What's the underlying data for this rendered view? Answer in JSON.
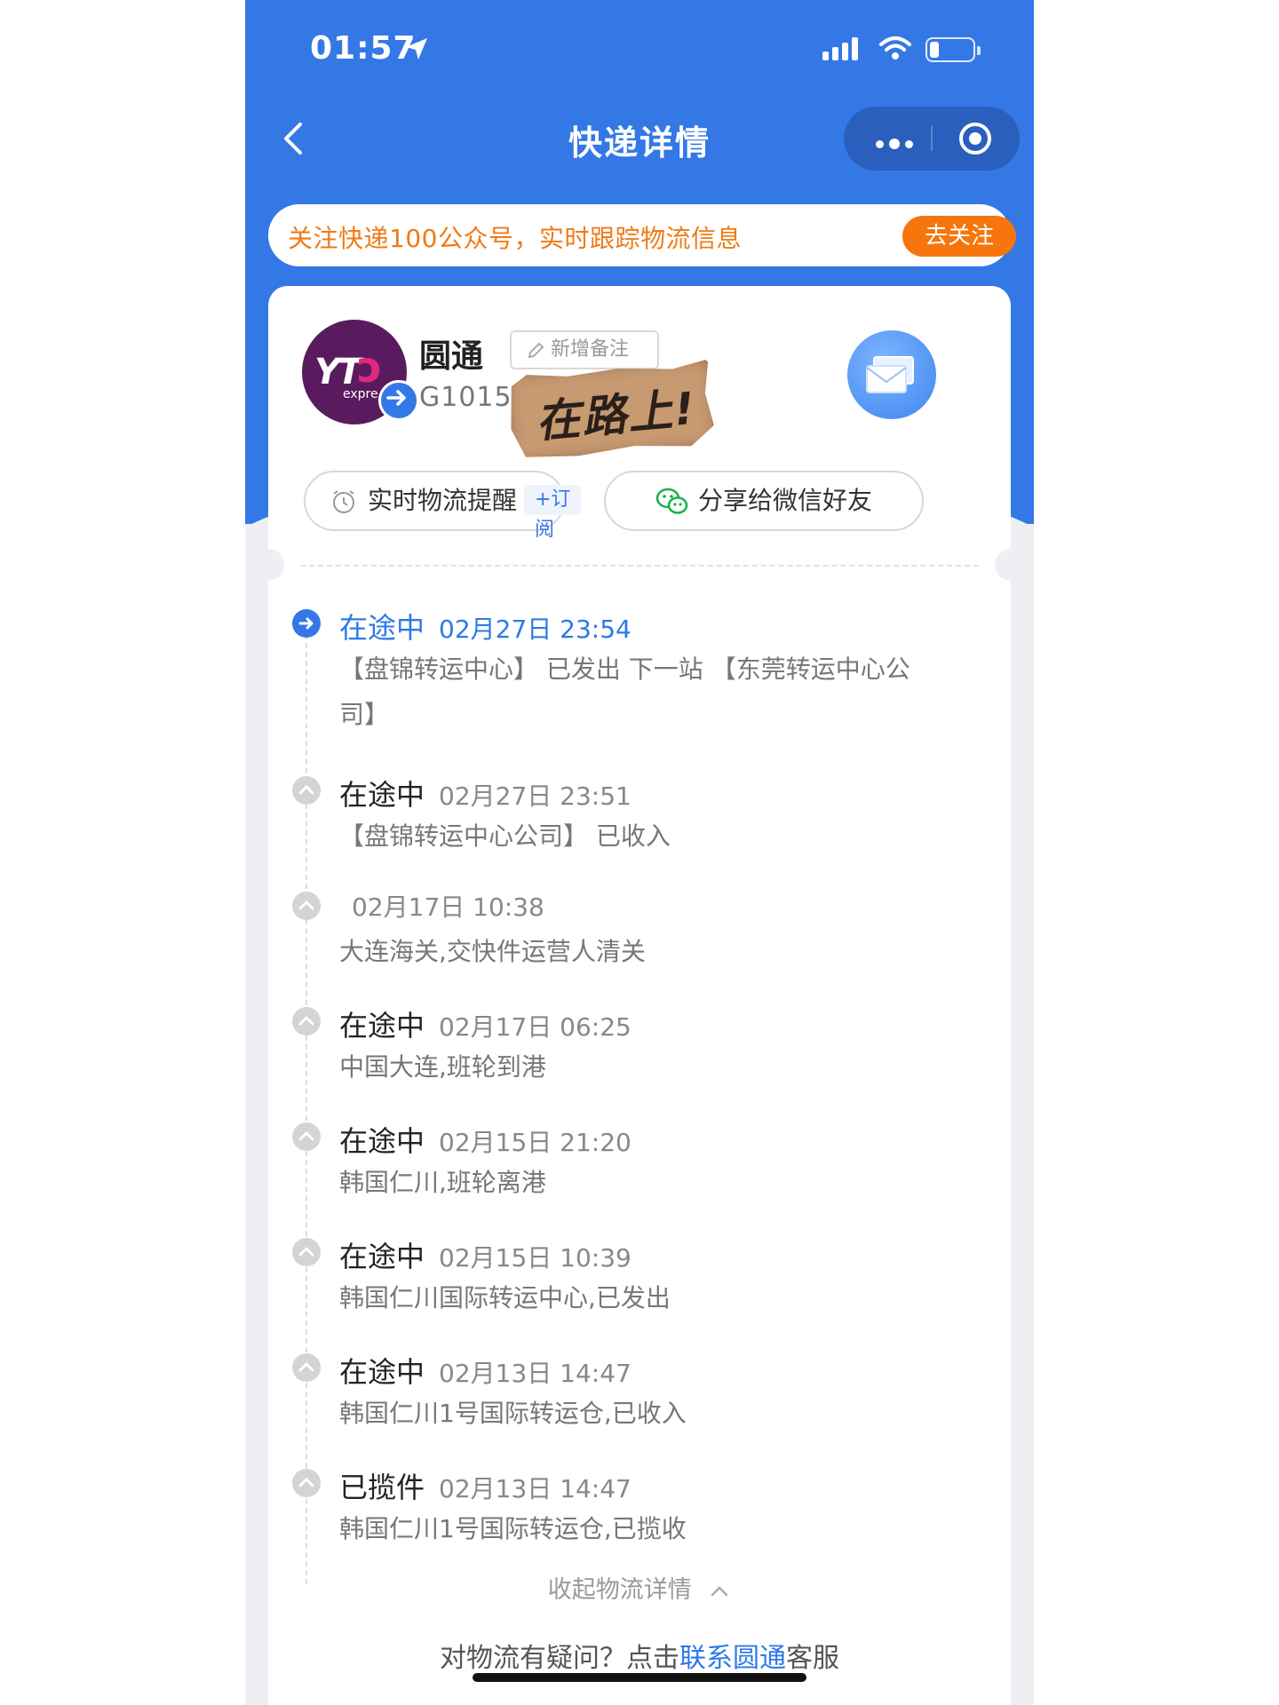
{
  "status_bar": {
    "time": "01:57"
  },
  "nav": {
    "title": "快递详情"
  },
  "banner": {
    "text": "关注快递100公众号，实时跟踪物流信息",
    "button": "去关注"
  },
  "package": {
    "logo_text": "YT",
    "logo_sub": "expre",
    "carrier": "圆通",
    "note_button": "新增备注",
    "tracking": "G101547",
    "sticker": "在路上!",
    "subscribe_label": "实时物流提醒",
    "subscribe_badge": "+订阅",
    "share_label": "分享给微信好友"
  },
  "timeline": [
    {
      "status": "在途中",
      "datetime": "02月27日 23:54",
      "desc": "【盘锦转运中心】 已发出 下一站 【东莞转运中心公司】",
      "active": true
    },
    {
      "status": "在途中",
      "datetime": "02月27日 23:51",
      "desc": "【盘锦转运中心公司】 已收入"
    },
    {
      "status": "",
      "datetime": "02月17日 10:38",
      "desc": "大连海关,交快件运营人清关"
    },
    {
      "status": "在途中",
      "datetime": "02月17日 06:25",
      "desc": "中国大连,班轮到港"
    },
    {
      "status": "在途中",
      "datetime": "02月15日 21:20",
      "desc": "韩国仁川,班轮离港"
    },
    {
      "status": "在途中",
      "datetime": "02月15日 10:39",
      "desc": "韩国仁川国际转运中心,已发出"
    },
    {
      "status": "在途中",
      "datetime": "02月13日 14:47",
      "desc": "韩国仁川1号国际转运仓,已收入"
    },
    {
      "status": "已揽件",
      "datetime": "02月13日 14:47",
      "desc": "韩国仁川1号国际转运仓,已揽收"
    }
  ],
  "footer": {
    "collapse": "收起物流详情",
    "help_prefix": "对物流有疑问？点击",
    "help_link": "联系圆通",
    "help_suffix": "客服"
  },
  "colors": {
    "primary": "#3478e6",
    "accent": "#f6760d"
  }
}
